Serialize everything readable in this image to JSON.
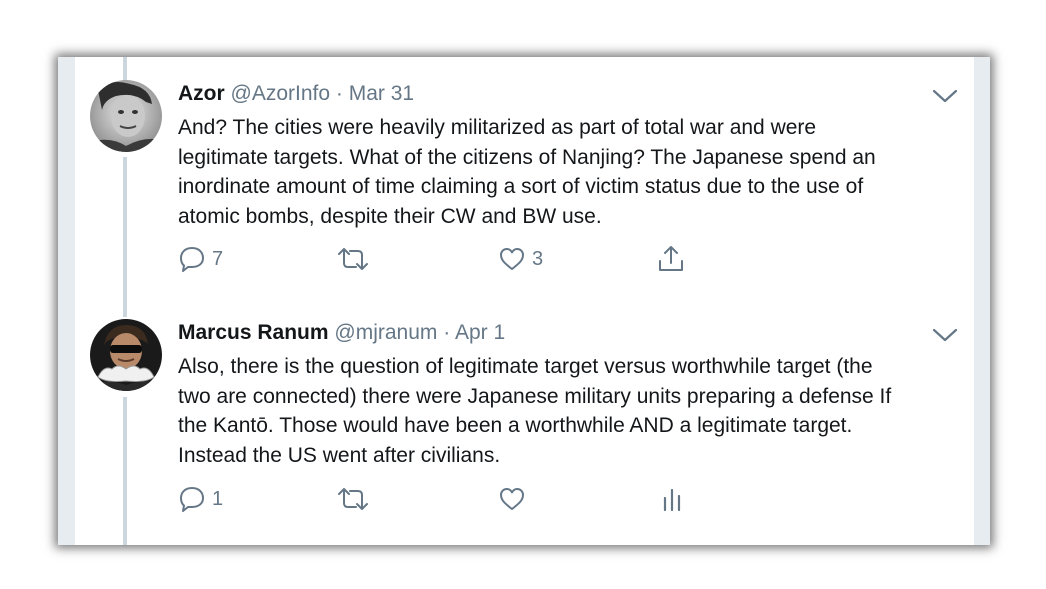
{
  "tweets": [
    {
      "name": "Azor",
      "handle": "@AzorInfo",
      "separator": "·",
      "date": "Mar 31",
      "text": "And?  The cities were heavily militarized as part of total war and were\nlegitimate targets.  What of the citizens of Nanjing?  The Japanese spend an\ninordinate amount of time claiming a sort of victim status due to the use of\natomic bombs, despite their CW and BW use.",
      "reply_count": "7",
      "like_count": "3",
      "fourth_action_icon": "share-icon"
    },
    {
      "name": "Marcus Ranum",
      "handle": "@mjranum",
      "separator": "·",
      "date": "Apr 1",
      "text": "Also, there is the question of legitimate target versus worthwhile target (the\ntwo are connected) there were Japanese military units preparing a defense If\nthe Kantō. Those would have been a worthwhile AND a legitimate target.\nInstead the US went after civilians.",
      "reply_count": "1",
      "like_count": "",
      "fourth_action_icon": "analytics-icon"
    }
  ],
  "colors": {
    "text_primary": "#14171a",
    "text_secondary": "#657786",
    "thread_line": "#ccd6dd",
    "gutter": "#e6ecf0"
  }
}
